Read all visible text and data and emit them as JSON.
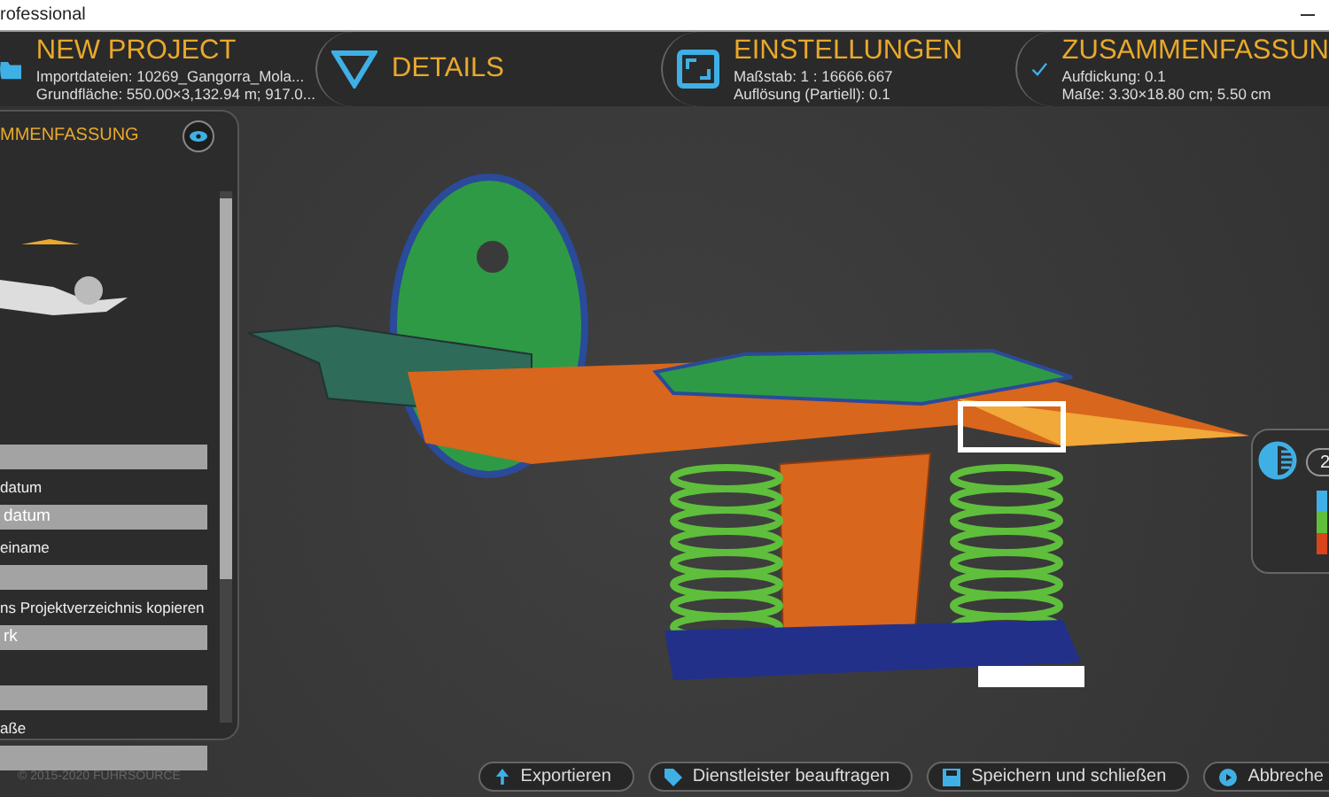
{
  "window": {
    "title": "rofessional"
  },
  "header": [
    {
      "kind": "folder",
      "title": "NEW PROJECT",
      "lines": [
        "Importdateien: 10269_Gangorra_Mola...",
        "Grundfläche: 550.00×3,132.94 m; 917.0..."
      ]
    },
    {
      "kind": "triangle",
      "title": "DETAILS"
    },
    {
      "kind": "frame",
      "title": "EINSTELLUNGEN",
      "lines": [
        "Maßstab: 1 : 16666.667",
        "Auflösung (Partiell): 0.1"
      ]
    },
    {
      "kind": "check",
      "title": "ZUSAMMENFASSUN",
      "lines": [
        "Aufdickung: 0.1",
        "Maße: 3.30×18.80 cm; 5.50 cm"
      ]
    }
  ],
  "panel": {
    "title": "MMENFASSUNG",
    "rows": [
      {
        "kind": "field"
      },
      {
        "kind": "label",
        "text": "datum"
      },
      {
        "kind": "field",
        "text": "datum"
      },
      {
        "kind": "label",
        "text": "einame"
      },
      {
        "kind": "field"
      },
      {
        "kind": "label",
        "text": "ns Projektverzeichnis kopieren"
      },
      {
        "kind": "field",
        "text": "rk"
      },
      {
        "kind": "spacer"
      },
      {
        "kind": "field"
      },
      {
        "kind": "label",
        "text": "aße"
      },
      {
        "kind": "field"
      }
    ]
  },
  "side_panel": {
    "badge": "2"
  },
  "copyright": "© 2015-2020 FUHRSOURCE",
  "buttons": [
    {
      "kind": "export",
      "label": "Exportieren"
    },
    {
      "kind": "tag",
      "label": "Dienstleister beauftragen"
    },
    {
      "kind": "save",
      "label": "Speichern und schließen"
    },
    {
      "kind": "cancel",
      "label": "Abbreche"
    }
  ]
}
